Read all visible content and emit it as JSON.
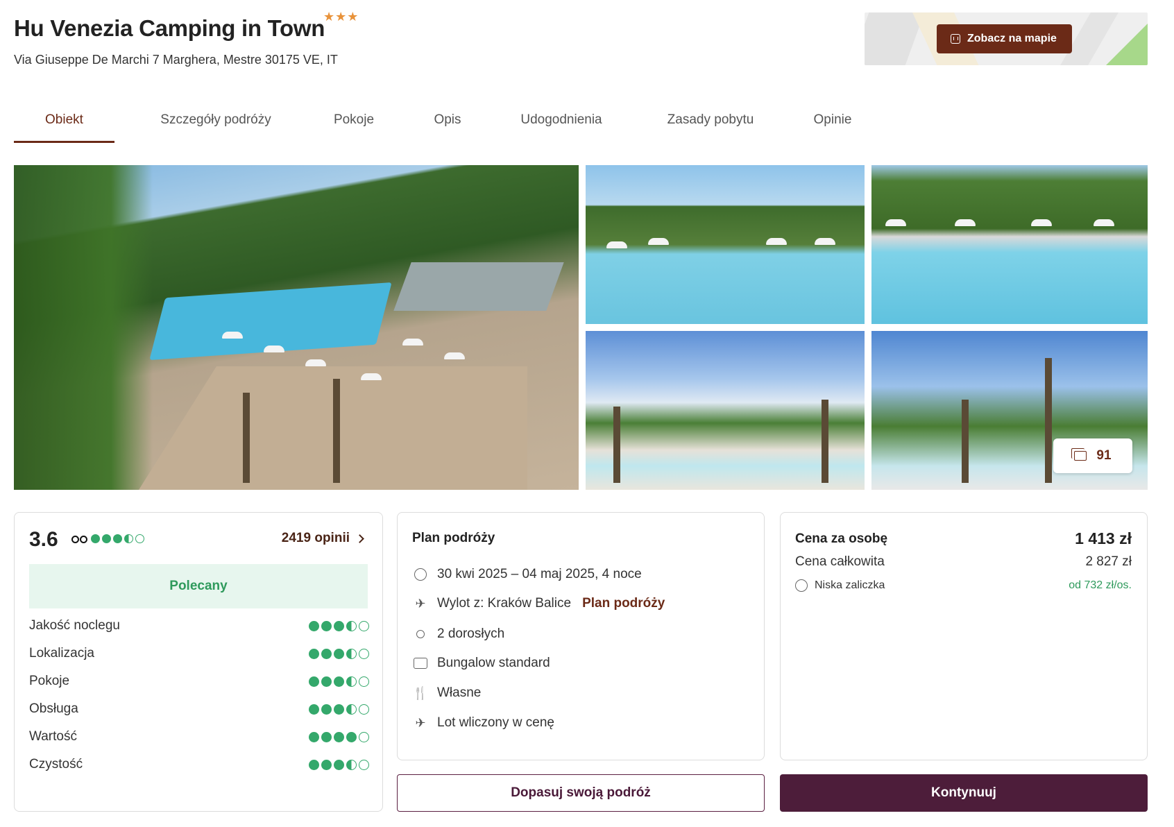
{
  "hotel": {
    "name": "Hu Venezia Camping in Town",
    "stars": "★★★",
    "address": "Via Giuseppe De Marchi 7 Marghera, Mestre 30175 VE, IT",
    "map_button_label": "Zobacz na mapie"
  },
  "tabs": [
    {
      "label": "Obiekt",
      "active": true
    },
    {
      "label": "Szczegóły podróży",
      "active": false
    },
    {
      "label": "Pokoje",
      "active": false
    },
    {
      "label": "Opis",
      "active": false
    },
    {
      "label": "Udogodnienia",
      "active": false
    },
    {
      "label": "Zasady pobytu",
      "active": false
    },
    {
      "label": "Opinie",
      "active": false
    }
  ],
  "gallery": {
    "photo_count": "91"
  },
  "rating": {
    "score": "3.6",
    "tripadvisor_dots": 3.5,
    "reviews_link": "2419 opinii",
    "recommended_label": "Polecany",
    "categories": [
      {
        "label": "Jakość noclegu",
        "dots": 3.5
      },
      {
        "label": "Lokalizacja",
        "dots": 3.5
      },
      {
        "label": "Pokoje",
        "dots": 3.5
      },
      {
        "label": "Obsługa",
        "dots": 3.5
      },
      {
        "label": "Wartość",
        "dots": 4
      },
      {
        "label": "Czystość",
        "dots": 3.5
      }
    ]
  },
  "plan": {
    "title": "Plan podróży",
    "dates": "30 kwi 2025 – 04 maj 2025, 4 noce",
    "departure": "Wylot z: Kraków Balice",
    "departure_link": "Plan podróży",
    "guests": "2 dorosłych",
    "room": "Bungalow standard",
    "board": "Własne",
    "flight": "Lot wliczony w cenę"
  },
  "price": {
    "per_person_label": "Cena za osobę",
    "per_person_value": "1 413 zł",
    "total_label": "Cena całkowita",
    "total_value": "2 827 zł",
    "deposit_label": "Niska zaliczka",
    "deposit_value": "od 732 zł/os."
  },
  "actions": {
    "customize_label": "Dopasuj swoją podróż",
    "continue_label": "Kontynuuj"
  },
  "colors": {
    "brand": "#6b2a17",
    "primary_button": "#4d1d3a",
    "rating_green": "#34a86b"
  }
}
